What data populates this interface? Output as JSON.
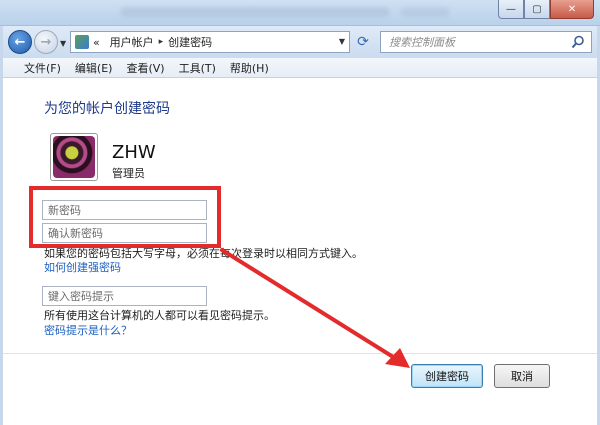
{
  "window": {
    "minimize_glyph": "—",
    "maximize_glyph": "▢",
    "close_glyph": "✕"
  },
  "nav": {
    "back_glyph": "←",
    "forward_glyph": "→",
    "breadcrumb_prefix": "«",
    "breadcrumb": [
      "用户帐户",
      "创建密码"
    ],
    "separator": "▸",
    "search_placeholder": "搜索控制面板",
    "refresh_glyph": "⟳"
  },
  "menubar": {
    "items": [
      "文件(F)",
      "编辑(E)",
      "查看(V)",
      "工具(T)",
      "帮助(H)"
    ]
  },
  "page": {
    "title": "为您的帐户创建密码",
    "username": "ZHW",
    "role": "管理员",
    "new_password_placeholder": "新密码",
    "confirm_password_placeholder": "确认新密码",
    "case_note": "如果您的密码包括大写字母，必须在每次登录时以相同方式键入。",
    "strong_password_link": "如何创建强密码",
    "hint_placeholder": "键入密码提示",
    "hint_note": "所有使用这台计算机的人都可以看见密码提示。",
    "hint_question_link": "密码提示是什么？",
    "create_button": "创建密码",
    "cancel_button": "取消"
  },
  "annotation": {
    "color": "#e42b2b"
  }
}
